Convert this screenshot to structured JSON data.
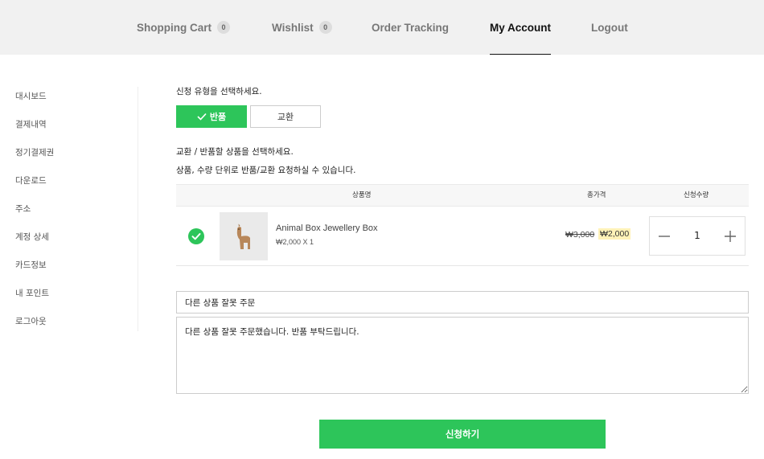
{
  "nav": {
    "items": [
      {
        "label": "Shopping Cart",
        "badge": "0"
      },
      {
        "label": "Wishlist",
        "badge": "0"
      },
      {
        "label": "Order Tracking"
      },
      {
        "label": "My Account",
        "active": true
      },
      {
        "label": "Logout"
      }
    ]
  },
  "sidebar": {
    "items": [
      {
        "label": "대시보드"
      },
      {
        "label": "결제내역"
      },
      {
        "label": "정기결제권"
      },
      {
        "label": "다운로드"
      },
      {
        "label": "주소"
      },
      {
        "label": "계정 상세"
      },
      {
        "label": "카드정보"
      },
      {
        "label": "내 포인트"
      },
      {
        "label": "로그아웃"
      }
    ]
  },
  "form": {
    "type_prompt": "신청 유형을 선택하세요.",
    "type_options": {
      "return": "반품",
      "exchange": "교환"
    },
    "select_prompt": "교환 / 반품할 상품을 선택하세요.",
    "select_hint": "상품, 수량 단위로 반품/교환 요청하실 수 있습니다.",
    "table": {
      "headers": {
        "product": "상품명",
        "total": "총가격",
        "qty": "신청수량"
      },
      "row": {
        "name": "Animal Box Jewellery Box",
        "unit": "₩2,000 X 1",
        "old_price": "₩3,000",
        "new_price": "₩2,000",
        "qty": "1"
      }
    },
    "reason": "다른 상품 잘못 주문",
    "detail": "다른 상품 잘못 주문했습니다. 반품 부탁드립니다.",
    "submit": "신청하기"
  },
  "colors": {
    "accent": "#2dc55a",
    "highlight": "#fff2b8"
  }
}
